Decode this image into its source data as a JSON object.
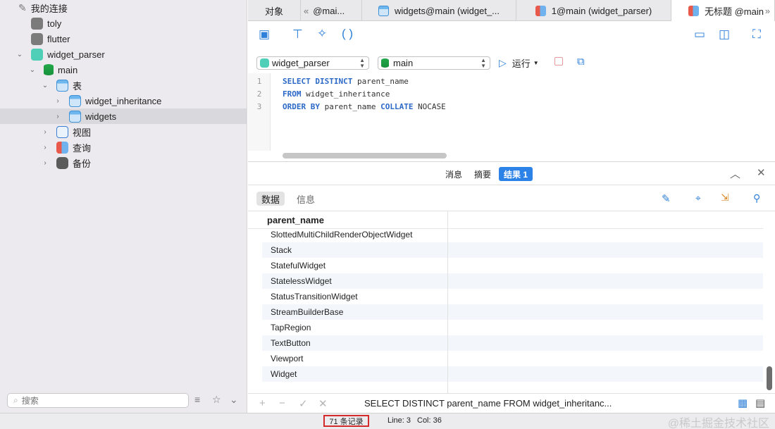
{
  "sidebar": {
    "connections_label": "我的连接",
    "tree": [
      {
        "label": "toly",
        "icon": "connection-icon"
      },
      {
        "label": "flutter",
        "icon": "connection-icon"
      },
      {
        "label": "widget_parser",
        "icon": "sqlite-connection-icon"
      },
      {
        "label": "main",
        "icon": "database-icon"
      },
      {
        "label": "表",
        "icon": "tables-folder-icon"
      },
      {
        "label": "widget_inheritance",
        "icon": "table-icon"
      },
      {
        "label": "widgets",
        "icon": "table-icon"
      },
      {
        "label": "视图",
        "icon": "views-icon"
      },
      {
        "label": "查询",
        "icon": "queries-icon"
      },
      {
        "label": "备份",
        "icon": "backups-icon"
      }
    ],
    "search_placeholder": "搜索"
  },
  "tabs": [
    {
      "label": "对象"
    },
    {
      "label": "@mai..."
    },
    {
      "label": "widgets@main (widget_..."
    },
    {
      "label": "1@main (widget_parser)"
    },
    {
      "label": "无标题 @main"
    }
  ],
  "selectors": {
    "connection": "widget_parser",
    "database": "main",
    "run_label": "运行"
  },
  "editor": {
    "line_numbers": [
      "1",
      "2",
      "3"
    ],
    "lines": [
      {
        "kw": "SELECT DISTINCT",
        "rest": " parent_name"
      },
      {
        "kw": "FROM",
        "rest": " widget_inheritance"
      },
      {
        "kw": "ORDER BY",
        "rest": " parent_name ",
        "kw2": "COLLATE",
        "rest2": " NOCASE"
      }
    ]
  },
  "result_tabs": {
    "messages": "消息",
    "summary": "摘要",
    "result": "结果 1"
  },
  "data_tabs": {
    "data": "数据",
    "info": "信息"
  },
  "grid": {
    "column": "parent_name",
    "rows": [
      "SlottedMultiChildRenderObjectWidget",
      "Stack",
      "StatefulWidget",
      "StatelessWidget",
      "StatusTransitionWidget",
      "StreamBuilderBase",
      "TapRegion",
      "TextButton",
      "Viewport",
      "Widget"
    ]
  },
  "bottom": {
    "sql_preview": "SELECT DISTINCT parent_name FROM widget_inheritanc..."
  },
  "status": {
    "records": "71 条记录",
    "line": "Line: 3",
    "col": "Col: 36",
    "watermark": "@稀土掘金技术社区"
  },
  "colors": {
    "accent": "#2c82e6",
    "keyword": "#2c69c7",
    "highlight_border": "#d42a2a"
  }
}
